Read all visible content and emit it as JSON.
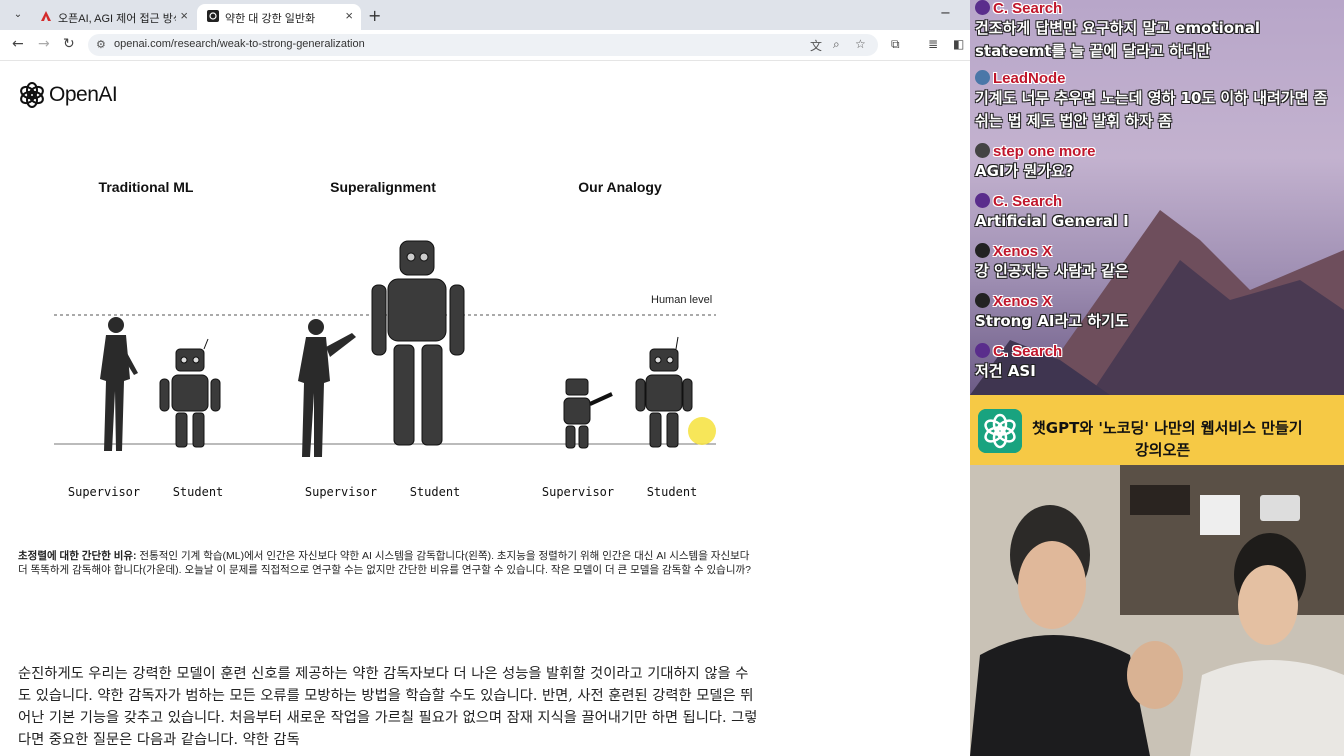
{
  "browser": {
    "tabs": [
      {
        "title": "오픈AI, AGI 제어 접근 방식 공",
        "active": false
      },
      {
        "title": "약한 대 강한 일반화",
        "active": true
      }
    ],
    "url": "openai.com/research/weak-to-strong-generalization"
  },
  "page": {
    "logo_text": "OpenAI",
    "figure": {
      "columns": [
        {
          "title": "Traditional ML",
          "roles": [
            "Supervisor",
            "Student"
          ]
        },
        {
          "title": "Superalignment",
          "roles": [
            "Supervisor",
            "Student"
          ]
        },
        {
          "title": "Our Analogy",
          "roles": [
            "Supervisor",
            "Student"
          ]
        }
      ],
      "human_level_label": "Human level"
    },
    "caption_bold": "초정렬에 대한 간단한 비유:",
    "caption_text": " 전통적인 기계 학습(ML)에서 인간은 자신보다 약한 AI 시스템을 감독합니다(왼쪽). 초지능을 정렬하기 위해 인간은 대신 AI 시스템을 자신보다 더 똑똑하게 감독해야 합니다(가운데). 오늘날 이 문제를 직접적으로 연구할 수는 없지만 간단한 비유를 연구할 수 있습니다. 작은 모델이 더 큰 모델을 감독할 수 있습니까?",
    "body_text": "순진하게도 우리는 강력한 모델이 훈련 신호를 제공하는 약한 감독자보다 더 나은 성능을 발휘할 것이라고 기대하지 않을 수도 있습니다. 약한 감독자가 범하는 모든 오류를 모방하는 방법을 학습할 수도 있습니다. 반면, 사전 훈련된 강력한 모델은 뛰어난 기본 기능을 갖추고 있습니다. 처음부터 새로운 작업을 가르칠 필요가 없으며 잠재 지식을 끌어내기만 하면 됩니다. 그렇다면 중요한 질문은 다음과 같습니다. 약한 감독"
  },
  "chat": [
    {
      "name": "C. Search",
      "text": "건조하게 답변만 요구하지 말고 emotional stateemt를 늘 끝에 달라고 하더만"
    },
    {
      "name": "LeadNode",
      "text": "기계도 너무 추우면 노는데 영하 10도 이하 내려가면 좀 쉬는 법 제도 법안 발휘 하자 좀"
    },
    {
      "name": "step one more",
      "text": "AGI가 뭔가요?"
    },
    {
      "name": "C. Search",
      "text": "Artificial General I"
    },
    {
      "name": "Xenos X",
      "text": "강 인공지능 사람과 같은"
    },
    {
      "name": "Xenos X",
      "text": "Strong AI라고 하기도"
    },
    {
      "name": "C. Search",
      "text": "저건 ASI"
    }
  ],
  "banner": {
    "line1": "챗GPT와 '노코딩' 나만의 웹서비스 만들기",
    "line2": "강의오픈"
  },
  "colors": {
    "chat_name": "#c0162c",
    "banner_bg": "#f6c945",
    "gpt_green": "#19a37f"
  }
}
